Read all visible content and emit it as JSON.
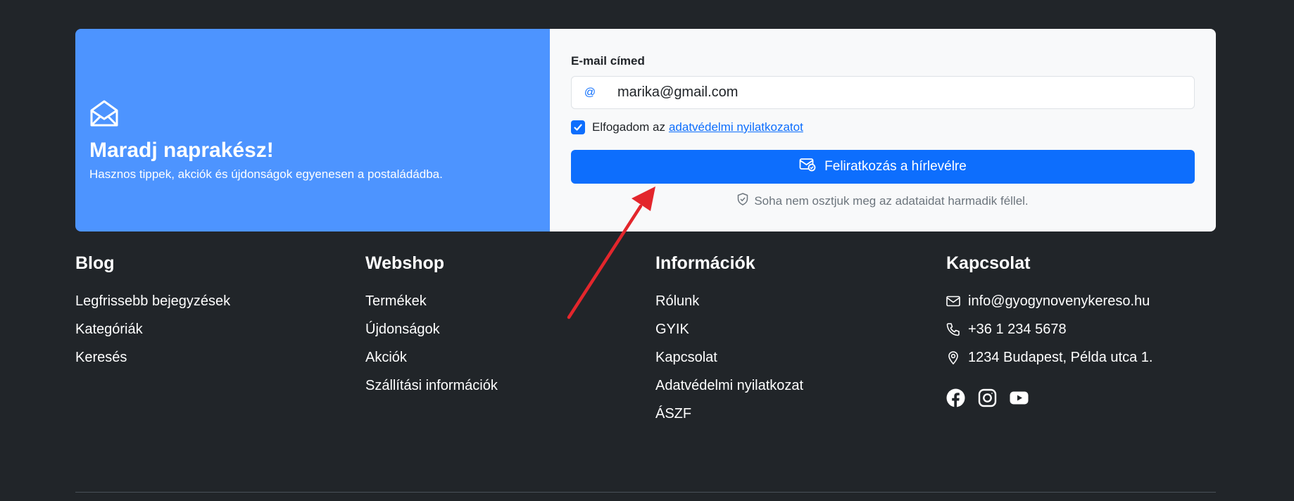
{
  "newsletter": {
    "title": "Maradj naprakész!",
    "subtitle": "Hasznos tippek, akciók és újdonságok egyenesen a postaládádba.",
    "email_label": "E-mail címed",
    "email_prefix": "@",
    "email_value": "marika@gmail.com",
    "consent_text": "Elfogadom az",
    "consent_link": "adatvédelmi nyilatkozatot",
    "consent_checked": true,
    "submit_label": "Feliratkozás a hírlevélre",
    "privacy_note": "Soha nem osztjuk meg az adataidat harmadik féllel.",
    "accent_color": "#4d94ff",
    "button_color": "#0d6efd"
  },
  "footer": {
    "blog": {
      "title": "Blog",
      "links": [
        "Legfrissebb bejegyzések",
        "Kategóriák",
        "Keresés"
      ]
    },
    "webshop": {
      "title": "Webshop",
      "links": [
        "Termékek",
        "Újdonságok",
        "Akciók",
        "Szállítási információk"
      ]
    },
    "info": {
      "title": "Információk",
      "links": [
        "Rólunk",
        "GYIK",
        "Kapcsolat",
        "Adatvédelmi nyilatkozat",
        "ÁSZF"
      ]
    },
    "contact": {
      "title": "Kapcsolat",
      "email": "info@gyogynovenykereso.hu",
      "phone": "+36 1 234 5678",
      "address": "1234 Budapest, Példa utca 1.",
      "social": [
        "facebook-icon",
        "instagram-icon",
        "youtube-icon"
      ]
    }
  },
  "annotation": {
    "type": "arrow",
    "color": "#e3262c"
  }
}
